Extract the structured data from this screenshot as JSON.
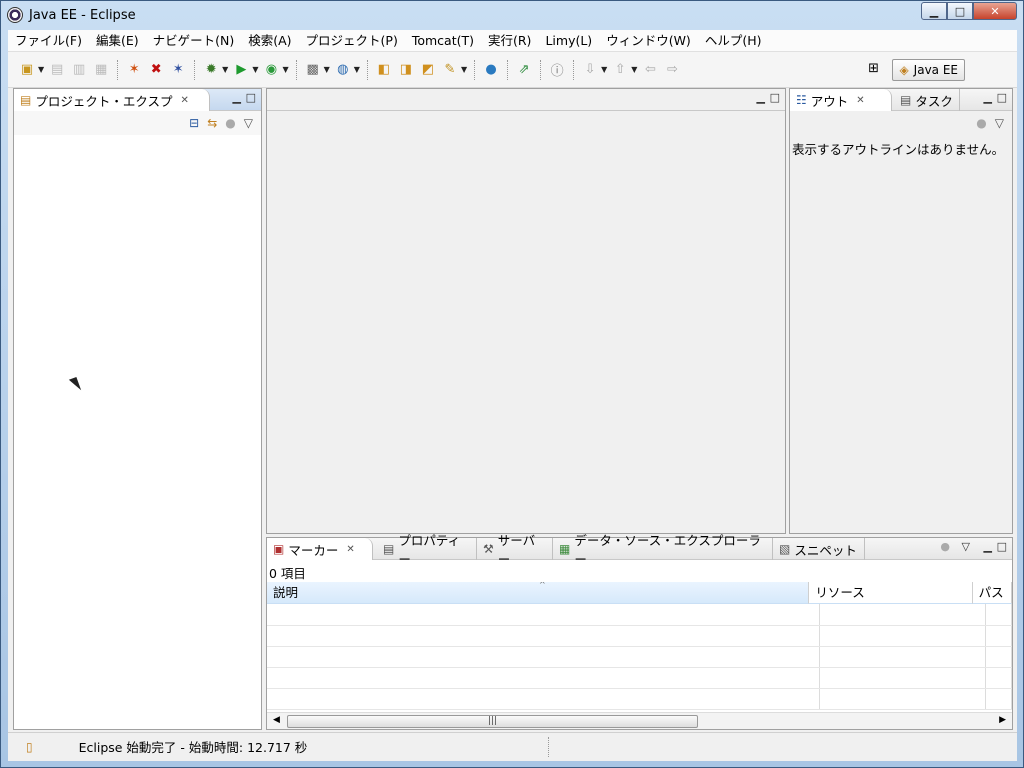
{
  "window": {
    "title": "Java EE - Eclipse",
    "min": "▁",
    "max": "□",
    "close": "✕"
  },
  "menubar": {
    "items": [
      "ファイル(F)",
      "編集(E)",
      "ナビゲート(N)",
      "検索(A)",
      "プロジェクト(P)",
      "Tomcat(T)",
      "実行(R)",
      "Limy(L)",
      "ウィンドウ(W)",
      "ヘルプ(H)"
    ]
  },
  "toolbar": {
    "perspective": "Java EE",
    "icons": [
      "new-icon",
      "save-icon",
      "save-all-icon",
      "print-icon",
      "tomcat-start-icon",
      "tomcat-stop-icon",
      "tomcat-restart-icon",
      "debug-icon",
      "run-icon",
      "run-external-icon",
      "new-server-icon",
      "new-web-service-icon",
      "open-type-icon",
      "open-task-icon",
      "open-resource-icon",
      "search-icon",
      "globe-icon",
      "deploy-icon",
      "info-icon",
      "next-annotation-icon",
      "prev-annotation-icon",
      "back-icon",
      "forward-icon"
    ]
  },
  "left_panel": {
    "tab": "プロジェクト・エクスプ"
  },
  "right_panel": {
    "tabs": [
      "アウト",
      "タスク"
    ],
    "message": "表示するアウトラインはありません。"
  },
  "bottom_panel": {
    "tabs": [
      "マーカー",
      "プロパティー",
      "サーバー",
      "データ・ソース・エクスプローラー",
      "スニペット"
    ],
    "count": "0 項目",
    "columns": [
      "説明",
      "リソース",
      "パス"
    ]
  },
  "status": {
    "text": "Eclipse 始動完了 - 始動時間: 12.717 秒"
  },
  "colors": {
    "accent": "#c9dff5",
    "title_bg": "#a8c5e4"
  }
}
